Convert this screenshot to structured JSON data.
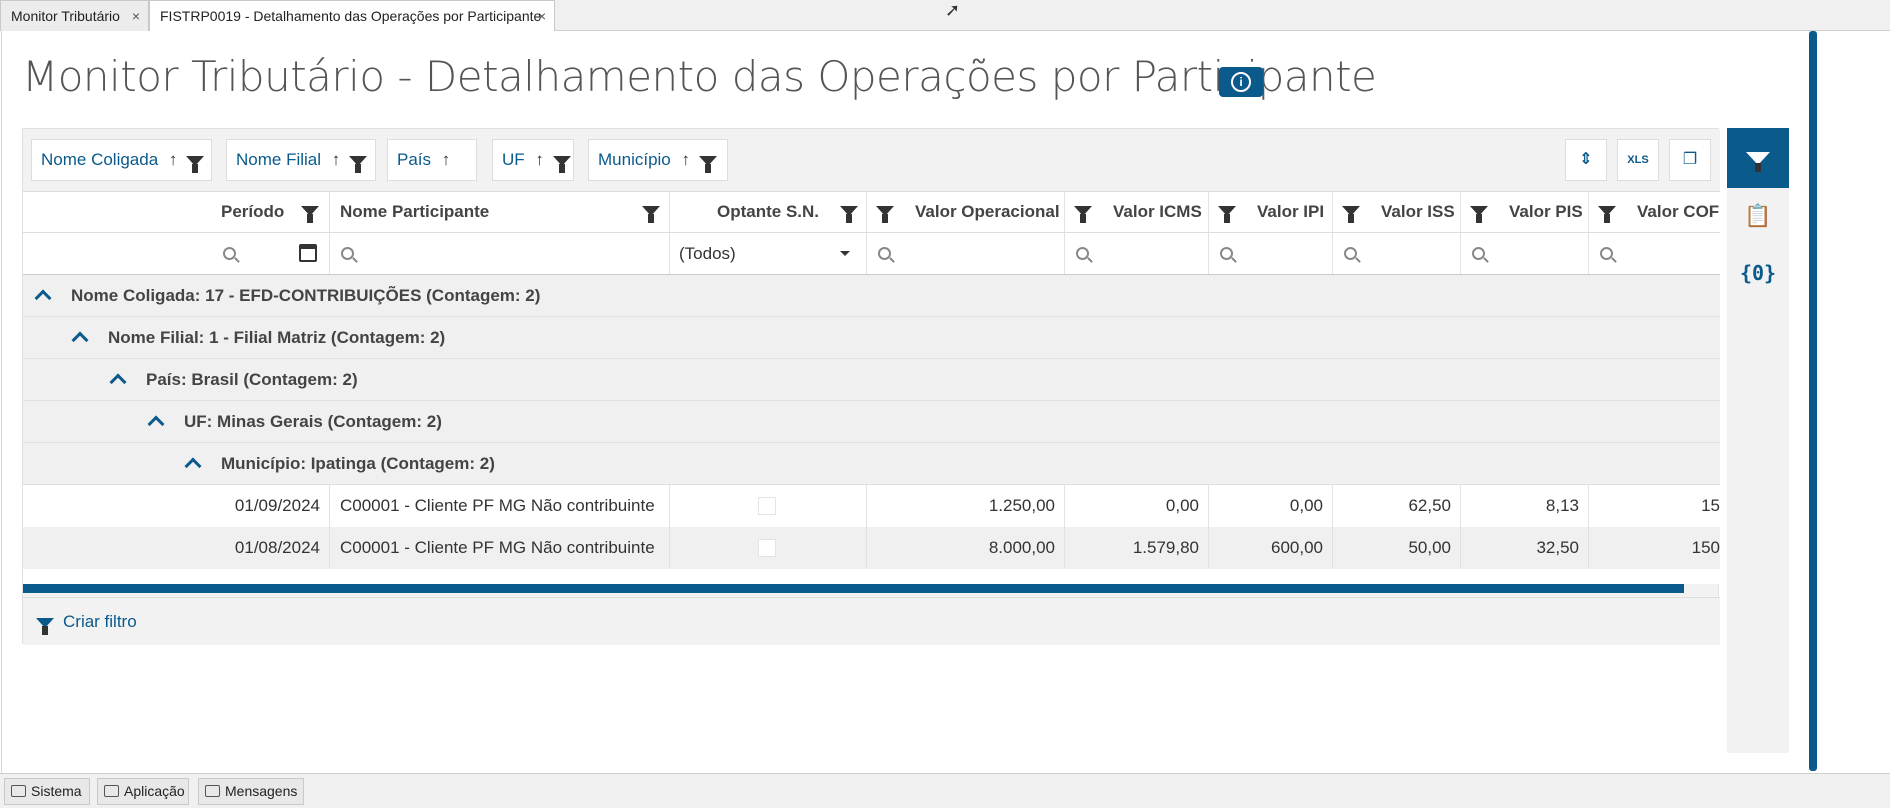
{
  "window_tabs": [
    {
      "label": "Monitor Tributário",
      "close": "×"
    },
    {
      "label": "FISTRP0019 - Detalhamento das Operações por Participante",
      "close": "×"
    }
  ],
  "page": {
    "title": "Monitor Tributário - Detalhamento das Operações por Participante",
    "info_icon": "i"
  },
  "group_chips": [
    "Nome Coligada",
    "Nome Filial",
    "País",
    "UF",
    "Município"
  ],
  "sort_arrow": "↑",
  "columns": [
    "Período",
    "Nome Participante",
    "Optante S.N.",
    "Valor Operacional",
    "Valor ICMS",
    "Valor IPI",
    "Valor ISS",
    "Valor PIS",
    "Valor COFI"
  ],
  "filter": {
    "optante_value": "(Todos)"
  },
  "groups": [
    "Nome Coligada: 17 - EFD-CONTRIBUIÇÕES (Contagem: 2)",
    "Nome Filial: 1 - Filial Matriz (Contagem: 2)",
    "País: Brasil (Contagem: 2)",
    "UF: Minas Gerais (Contagem: 2)",
    "Município: Ipatinga (Contagem: 2)"
  ],
  "rows": [
    {
      "periodo": "01/09/2024",
      "participante": "C00001 - Cliente PF MG Não contribuinte",
      "operacional": "1.250,00",
      "icms": "0,00",
      "ipi": "0,00",
      "iss": "62,50",
      "pis": "8,13",
      "cofins": "15"
    },
    {
      "periodo": "01/08/2024",
      "participante": "C00001 - Cliente PF MG Não contribuinte",
      "operacional": "8.000,00",
      "icms": "1.579,80",
      "ipi": "600,00",
      "iss": "50,00",
      "pis": "32,50",
      "cofins": "150"
    }
  ],
  "footer": {
    "create_filter": "Criar filtro"
  },
  "toolbar": {
    "excel_label": "XLS"
  },
  "side_panel": {
    "variables_label": "{0}"
  },
  "statusbar": [
    "Sistema",
    "Aplicação",
    "Mensagens"
  ],
  "colors": {
    "accent": "#0a5a8c"
  }
}
